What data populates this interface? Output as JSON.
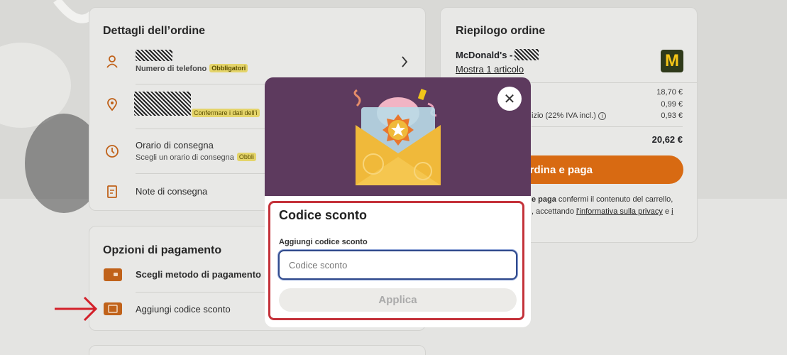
{
  "order_details": {
    "title": "Dettagli dell’ordine",
    "phone_label": "Numero di telefono",
    "phone_badge": "Obbligatori",
    "address_badge": "Confermare i dati dell’i",
    "delivery_time_title": "Orario di consegna",
    "delivery_time_sub": "Scegli un orario di consegna",
    "delivery_time_badge": "Obbli",
    "delivery_notes": "Note di consegna"
  },
  "payment": {
    "title": "Opzioni di pagamento",
    "choose_method": "Scegli metodo di pagamento",
    "add_discount": "Aggiungi codice sconto"
  },
  "summary": {
    "title": "Riepilogo ordine",
    "restaurant": "McDonald's -",
    "show_items": "Mostra 1 articolo",
    "lines": [
      {
        "label": "",
        "value": "18,70 €"
      },
      {
        "label": "",
        "value": "0,99 €"
      },
      {
        "label": "izio (22% IVA incl.)",
        "value": "0,93 €"
      }
    ],
    "total": "20,62 €",
    "order_button": "Ordina e paga",
    "legal_1a": "e paga",
    "legal_1b": " confermi il contenuto del carrello,",
    "legal_2a": ", accettando ",
    "legal_2b": "l'informativa sulla privacy",
    "legal_2c": " e ",
    "legal_2d": "i"
  },
  "modal": {
    "title": "Codice sconto",
    "input_label": "Aggiungi codice sconto",
    "input_placeholder": "Codice sconto",
    "input_value": "",
    "apply_button": "Applica",
    "close_symbol": "✕"
  },
  "colors": {
    "accent": "#d86a12",
    "modal_header": "#5d3a5e",
    "highlight_border": "#c4323a",
    "badge": "#e4d46a"
  },
  "icons": [
    "person-icon",
    "location-pin-icon",
    "clock-icon",
    "notes-icon",
    "wallet-icon",
    "coupon-icon",
    "chevron-right-icon",
    "close-icon",
    "info-icon",
    "mcdonalds-logo",
    "envelope-illustration",
    "red-arrow-icon"
  ]
}
